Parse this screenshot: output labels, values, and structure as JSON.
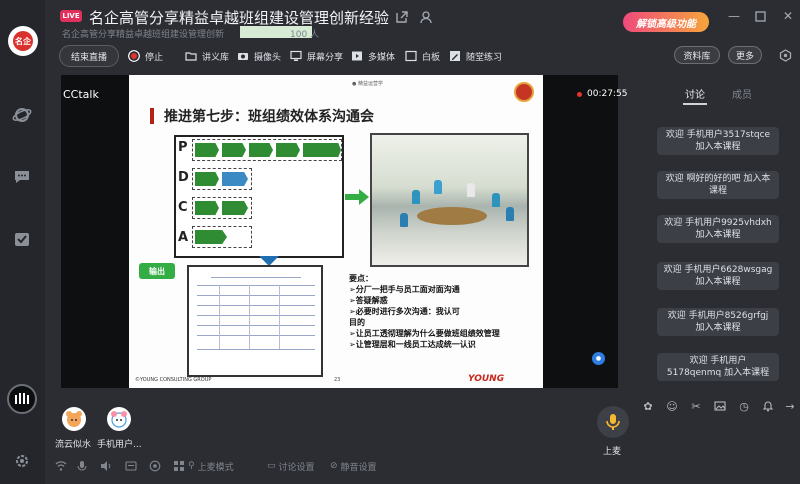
{
  "rail": {
    "logo_text": "名企"
  },
  "header": {
    "live_badge": "LIVE",
    "title": "名企高管分享精益卓越班组建设管理创新经验",
    "subtitle": "名企高管分享精益卓越班组建设管理创新",
    "member_count": "100 人",
    "unlock_label": "解锁高级功能"
  },
  "toolbar": {
    "end_live": "结束直播",
    "stop": "停止",
    "handout": "讲义库",
    "camera": "摄像头",
    "screen_share": "屏幕分享",
    "multimedia": "多媒体",
    "whiteboard": "白板",
    "exercise": "随堂练习",
    "resources": "资料库",
    "more": "更多"
  },
  "stage": {
    "brand": "CCtalk",
    "timer": "00:27:55",
    "slide": {
      "header_small": "● 精益运营学",
      "title": "推进第七步：班组绩效体系沟通会",
      "pdca": [
        "P",
        "D",
        "C",
        "A"
      ],
      "output_label": "输出",
      "key_points": [
        "要点：",
        "➢分厂一把手与员工面对面沟通",
        "➢答疑解惑",
        "➢必要时进行多次沟通：我认可",
        "目的",
        "➢让员工透彻理解为什么要做班组绩效管理",
        "➢让管理层和一线员工达成统一认识"
      ],
      "footer_left": "©YOUNG CONSULTING GROUP",
      "page_number": "23",
      "footer_brand": "YOUNG"
    }
  },
  "participants": [
    {
      "name": "流云似水"
    },
    {
      "name": "手机用户..."
    }
  ],
  "mic_label": "上麦",
  "bottom_bar": {
    "stage_mode": "上麦模式",
    "discussion_settings": "讨论设置",
    "mute_settings": "静音设置"
  },
  "chat": {
    "tab_discussion": "讨论",
    "tab_members": "成员",
    "messages": [
      "欢迎 手机用户3517stqce 加入本课程",
      "欢迎 啊好的好的吧 加入本课程",
      "欢迎 手机用户9925vhdxh 加入本课程",
      "欢迎 手机用户6628wsgag 加入本课程",
      "欢迎 手机用户8526grfgj 加入本课程",
      "欢迎 手机用户5178qenmq 加入本课程"
    ]
  },
  "colors": {
    "background": "#2b2d33",
    "live_badge": "#e0305c",
    "record_dot": "#e5322d",
    "slide_green": "#2f8c32",
    "slide_red": "#c8261b"
  }
}
